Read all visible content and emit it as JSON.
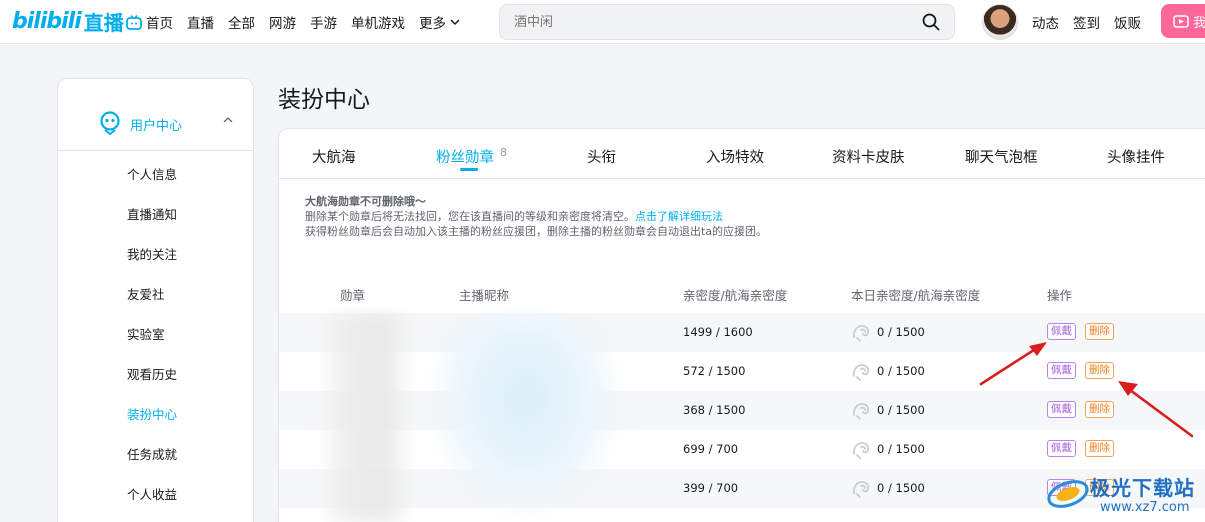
{
  "header": {
    "logo_text": "bilibili",
    "logo_suffix": "直播",
    "nav": [
      "首页",
      "直播",
      "全部",
      "网游",
      "手游",
      "单机游戏",
      "更多"
    ],
    "search": {
      "value": "",
      "placeholder": "酒中闲"
    },
    "right_nav": [
      "动态",
      "签到",
      "饭贩"
    ],
    "live_button": "我"
  },
  "sidebar": {
    "section": "用户中心",
    "items": [
      "个人信息",
      "直播通知",
      "我的关注",
      "友爱社",
      "实验室",
      "观看历史",
      "装扮中心",
      "任务成就",
      "个人收益"
    ],
    "active_item": "装扮中心"
  },
  "page": {
    "title": "装扮中心",
    "tabs": [
      {
        "label": "大航海"
      },
      {
        "label": "粉丝勋章",
        "count": "8"
      },
      {
        "label": "头衔"
      },
      {
        "label": "入场特效"
      },
      {
        "label": "资料卡皮肤"
      },
      {
        "label": "聊天气泡框"
      },
      {
        "label": "头像挂件"
      }
    ],
    "active_tab": "粉丝勋章",
    "notice": {
      "line1": "大航海勋章不可删除哦～",
      "line2": "删除某个勋章后将无法找回，您在该直播间的等级和亲密度将清空。",
      "link": "点击了解详细玩法",
      "line3": "获得粉丝勋章后会自动加入该主播的粉丝应援团，删除主播的粉丝勋章会自动退出ta的应援团。"
    },
    "table": {
      "headers": {
        "medal": "勋章",
        "anchor": "主播昵称",
        "intimacy": "亲密度/航海亲密度",
        "daily": "本日亲密度/航海亲密度",
        "ops": "操作"
      },
      "rows": [
        {
          "intimacy": "1499 / 1600",
          "daily": "0 / 1500"
        },
        {
          "intimacy": "572 / 1500",
          "daily": "0 / 1500"
        },
        {
          "intimacy": "368 / 1500",
          "daily": "0 / 1500"
        },
        {
          "intimacy": "699 / 700",
          "daily": "0 / 1500"
        },
        {
          "intimacy": "399 / 700",
          "daily": "0 / 1500"
        }
      ],
      "wear_label": "佩戴",
      "delete_label": "删除"
    }
  },
  "watermark": {
    "title": "极光下载站",
    "url": "www.xz7.com"
  },
  "colors": {
    "accent": "#00aeec",
    "wear": "#a45fe0",
    "delete": "#ee8020",
    "arrow": "#d81e1e"
  }
}
